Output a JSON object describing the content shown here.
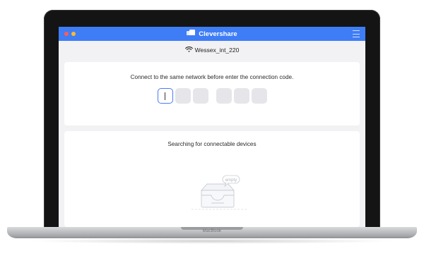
{
  "device": {
    "label": "MacBook"
  },
  "app": {
    "title": "Clevershare",
    "icons": {
      "logo": "cast-screen-icon",
      "menu": "hamburger-menu-icon",
      "wifi": "wifi-icon"
    },
    "colors": {
      "accent": "#3e7df6",
      "close": "#fd5e57",
      "minimize": "#fdbb2e"
    }
  },
  "network": {
    "name": "Wessex_int_220"
  },
  "connection": {
    "instruction": "Connect to the same network before enter the connection code.",
    "code_digits": [
      "",
      "",
      "",
      "",
      "",
      ""
    ],
    "active_index": 0
  },
  "devices": {
    "status": "Searching for connectable devices",
    "empty_label": "empty"
  }
}
